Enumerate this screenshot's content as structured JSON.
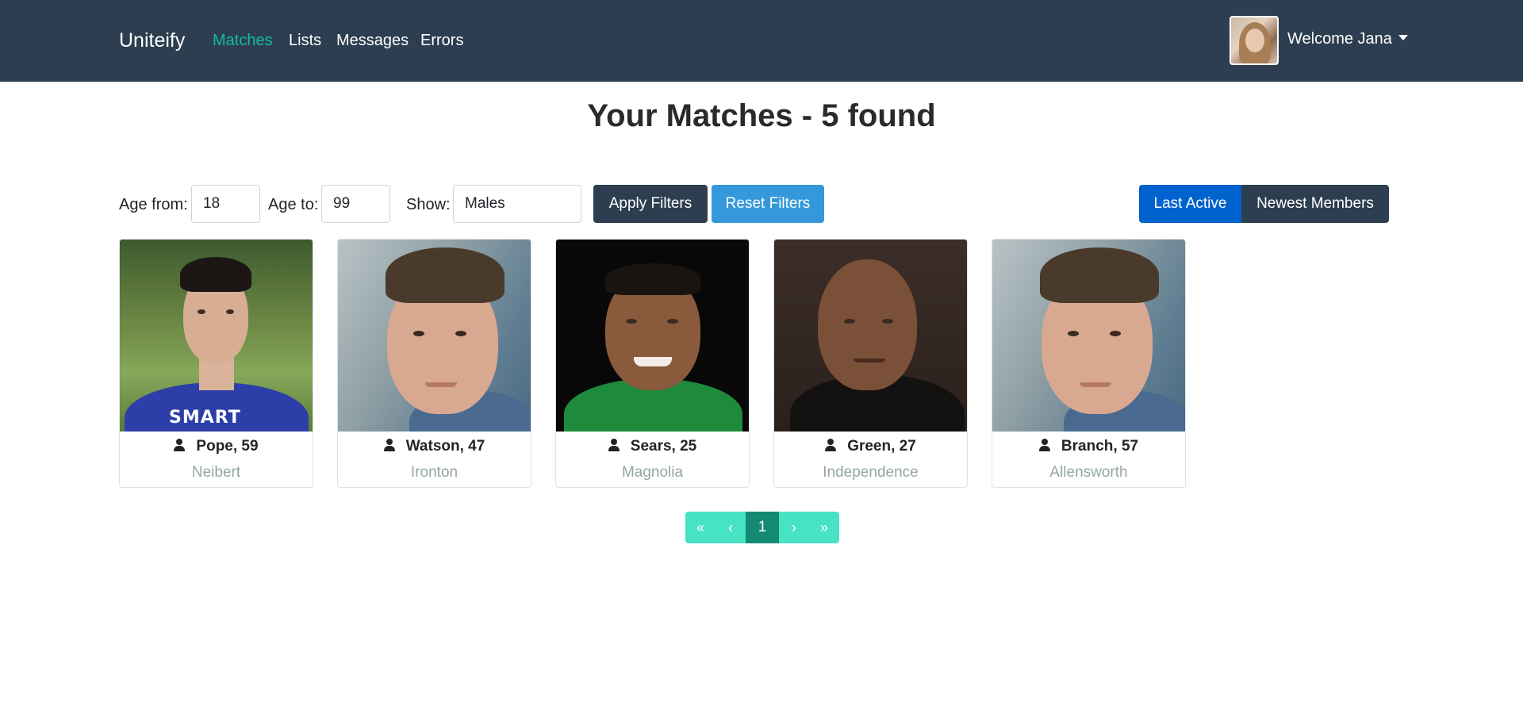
{
  "nav": {
    "brand": "Uniteify",
    "links": [
      "Matches",
      "Lists",
      "Messages",
      "Errors"
    ],
    "welcome": "Welcome Jana"
  },
  "title": "Your Matches - 5 found",
  "filters": {
    "age_from_label": "Age from:",
    "age_from_value": "18",
    "age_to_label": "Age to:",
    "age_to_value": "99",
    "show_label": "Show:",
    "show_value": "Males",
    "apply_label": "Apply Filters",
    "reset_label": "Reset Filters",
    "sort_last_active": "Last Active",
    "sort_newest": "Newest Members"
  },
  "members": [
    {
      "name": "Pope, 59",
      "city": "Neibert"
    },
    {
      "name": "Watson, 47",
      "city": "Ironton"
    },
    {
      "name": "Sears, 25",
      "city": "Magnolia"
    },
    {
      "name": "Green, 27",
      "city": "Independence"
    },
    {
      "name": "Branch, 57",
      "city": "Allensworth"
    }
  ],
  "photo_text": {
    "shirt_print": "SMART"
  },
  "pagination": {
    "first": "«",
    "prev": "‹",
    "current": "1",
    "next": "›",
    "last": "»"
  },
  "colors": {
    "navbar": "#2c3e50",
    "accent": "#18bc9c",
    "primary": "#3498db",
    "active_sort": "#0062cc",
    "pager": "#48e3c3",
    "pager_active": "#158a73"
  }
}
